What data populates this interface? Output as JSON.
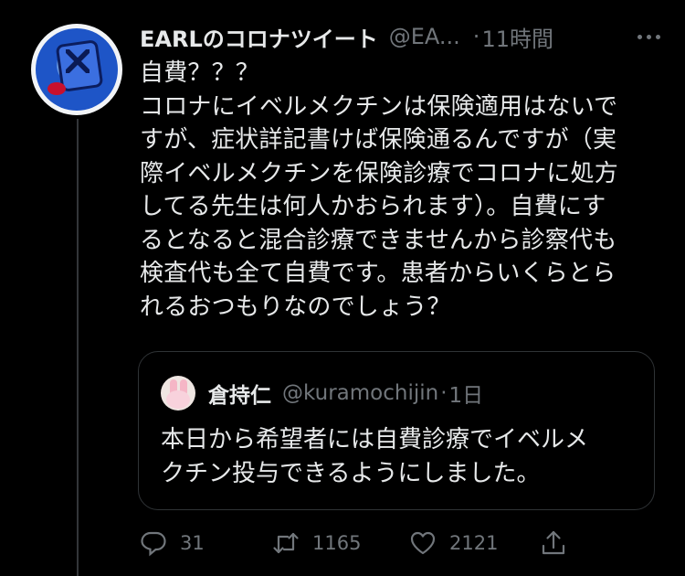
{
  "tweet": {
    "author_name": "EARLのコロナツイート",
    "handle": "@EA...",
    "separator": "·",
    "time": "11時間",
    "text_lines": [
      "自費？？？",
      "コロナにイベルメクチンは保険適用はないで",
      "すが、症状詳記書けば保険通るんですが（実",
      "際イベルメクチンを保険診療でコロナに処方",
      "してる先生は何人かおられます）。自費にす",
      "るとなると混合診療できませんから診察代も",
      "検査代も全て自費です。患者からいくらとら",
      "れるおつもりなのでしょう？"
    ],
    "more_icon": "more-dots-icon"
  },
  "quoted": {
    "author_name": "倉持仁",
    "handle": "@kuramochijin",
    "separator": "·",
    "time": "1日",
    "text_lines": [
      "本日から希望者には自費診療でイベルメ",
      "クチン投与できるようにしました。"
    ]
  },
  "actions": {
    "reply_count": "31",
    "retweet_count": "1165",
    "like_count": "2121",
    "icons": [
      "reply-icon",
      "retweet-icon",
      "like-icon",
      "share-icon"
    ]
  },
  "colors": {
    "background": "#000000",
    "text": "#e7e9ea",
    "muted": "#71767b",
    "border": "#2f3336"
  }
}
